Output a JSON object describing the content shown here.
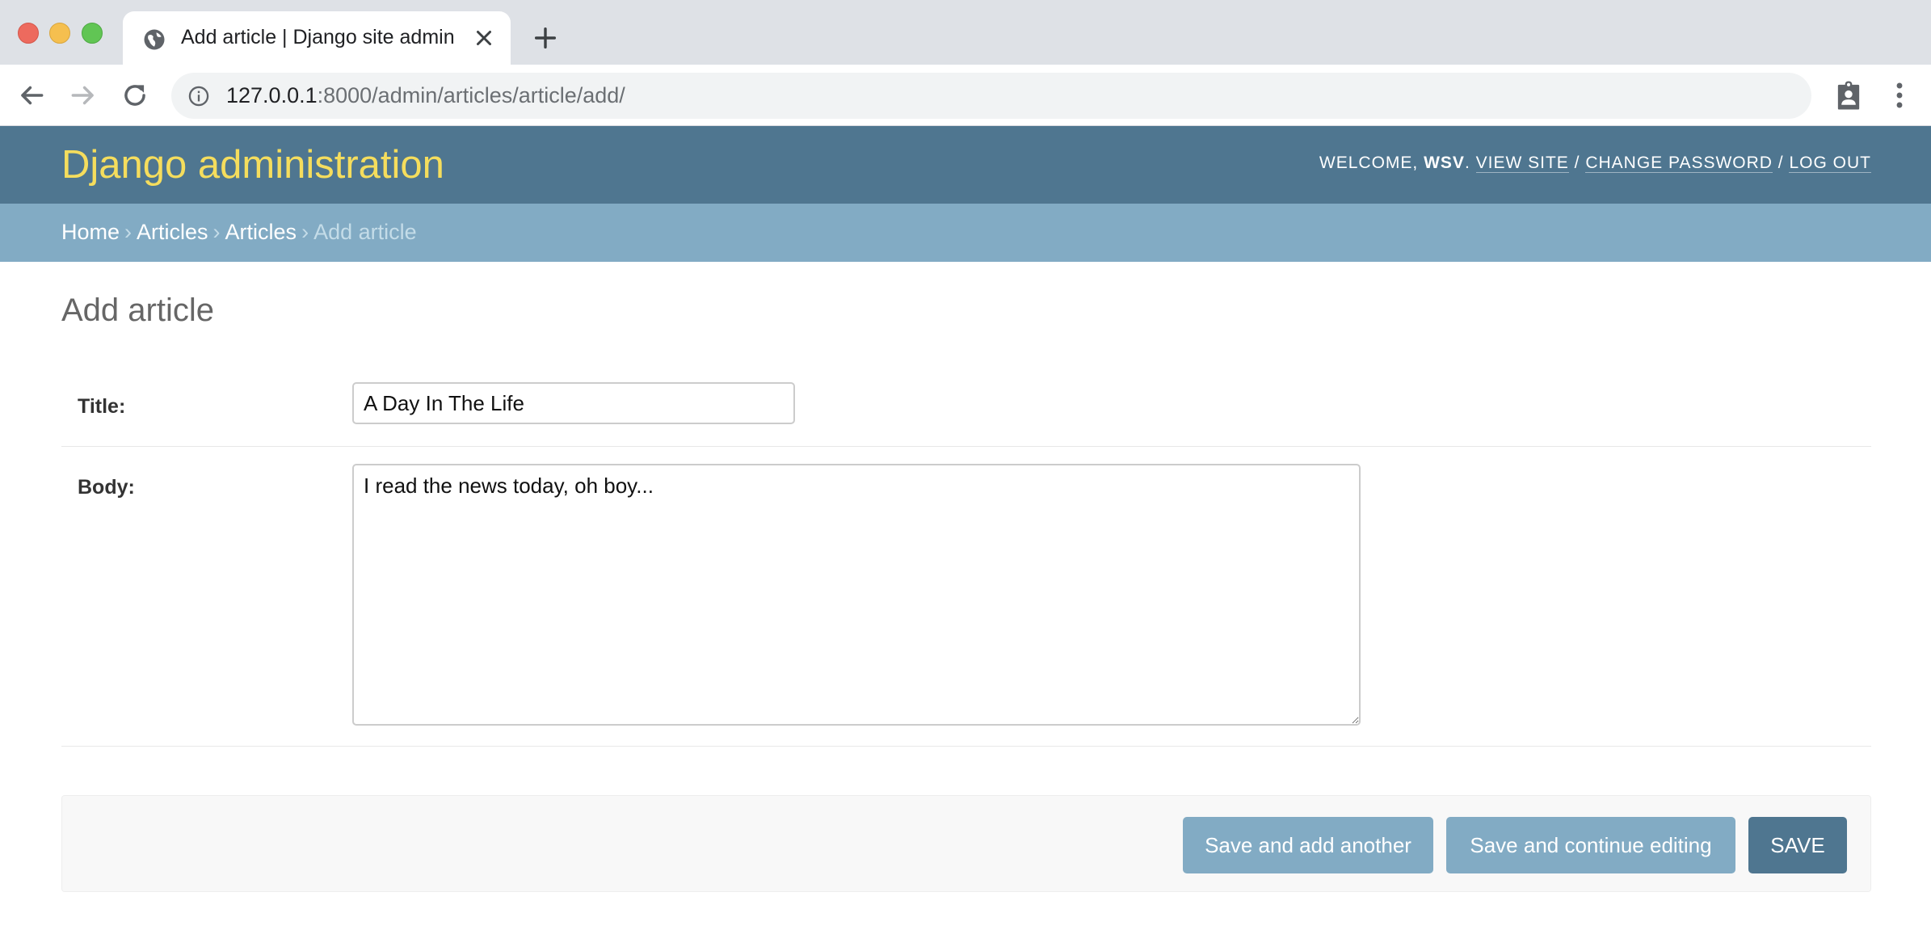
{
  "browser": {
    "tab_title": "Add article | Django site admin",
    "url_host": "127.0.0.1",
    "url_rest": ":8000/admin/articles/article/add/",
    "icons": {
      "favicon": "globe-icon",
      "close": "close-icon",
      "new_tab": "plus-icon",
      "back": "arrow-left-icon",
      "forward": "arrow-right-icon",
      "reload": "reload-icon",
      "info": "info-icon",
      "extension": "clipboard-badge-icon",
      "menu": "kebab-menu-icon"
    }
  },
  "header": {
    "branding": "Django administration",
    "welcome": "Welcome,",
    "username": "wsv",
    "view_site": "View site",
    "change_password": "Change password",
    "log_out": "Log out"
  },
  "breadcrumbs": {
    "home": "Home",
    "app": "Articles",
    "model": "Articles",
    "current": "Add article",
    "separator": "›"
  },
  "page": {
    "title": "Add article"
  },
  "form": {
    "title_label": "Title:",
    "title_value": "A Day In The Life",
    "body_label": "Body:",
    "body_value": "I read the news today, oh boy..."
  },
  "actions": {
    "save_add_another": "Save and add another",
    "save_continue": "Save and continue editing",
    "save": "Save"
  },
  "colors": {
    "header_bg": "#4f7690",
    "breadcrumbs_bg": "#82abc4",
    "branding_text": "#f5dd5d",
    "secondary_button": "#82abc4",
    "primary_button": "#4f7690"
  }
}
